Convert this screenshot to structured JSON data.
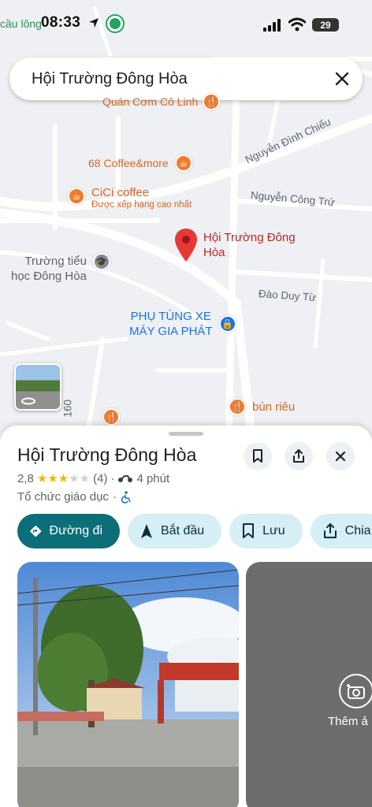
{
  "status_bar": {
    "left_fragment": "cầu lông",
    "time": "08:33",
    "battery": "29"
  },
  "search": {
    "query": "Hội Trường Đông Hòa"
  },
  "map": {
    "pois": [
      {
        "name": "Quán Cơm Cô Linh",
        "icon": "restaurant-icon"
      },
      {
        "name": "68 Coffee&more",
        "icon": "coffee-icon"
      },
      {
        "name": "CiCi coffee",
        "sub": "Được xếp hạng cao nhất",
        "icon": "coffee-icon"
      },
      {
        "name": "Hội Trường Đông Hòa",
        "icon": "red-pin-icon"
      },
      {
        "name_line1": "Trường tiểu",
        "name_line2": "học Đông Hòa",
        "icon": "school-icon"
      },
      {
        "name_line1": "PHỤ TÙNG XE",
        "name_line2": "MÁY GIA PHÁT",
        "icon": "shopping-bag-icon"
      },
      {
        "name": "bún riêu",
        "icon": "restaurant-icon"
      }
    ],
    "roads": [
      "Nguyễn Đình Chiểu",
      "Nguyễn Công Trứ",
      "Đào Duy Từ",
      "160"
    ]
  },
  "place": {
    "title": "Hội Trường Đông Hòa",
    "rating": "2,8",
    "rating_value": 2.8,
    "review_count": "(4)",
    "travel_time": "4 phút",
    "category": "Tổ chức giáo dục",
    "separator": "·"
  },
  "actions": {
    "directions": "Đường đi",
    "start": "Bắt đầu",
    "save": "Lưu",
    "share": "Chia"
  },
  "photos": {
    "add_photo": "Thêm ả"
  },
  "colors": {
    "primary": "#0b6e78",
    "tonal": "#d6eef6",
    "poi_orange": "#f07a2b",
    "pin_red": "#e53935",
    "shop_blue": "#1a73e8"
  }
}
